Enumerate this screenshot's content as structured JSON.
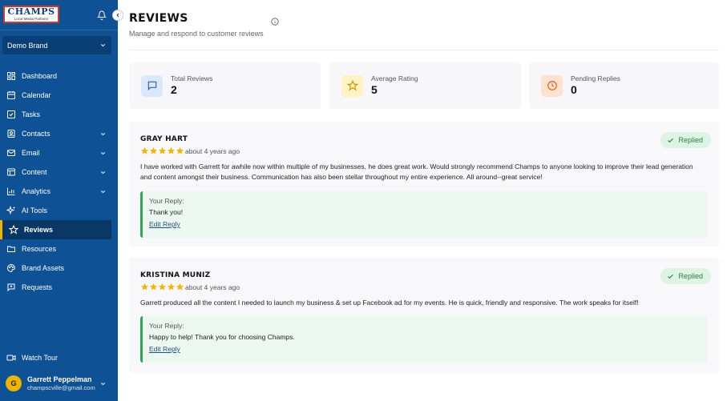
{
  "brand": {
    "logo_title": "CHAMPS",
    "logo_tagline": "Local Media Partners"
  },
  "brand_selector": {
    "value": "Demo Brand"
  },
  "sidebar": {
    "items": [
      {
        "label": "Dashboard",
        "icon": "dashboard-icon"
      },
      {
        "label": "Calendar",
        "icon": "calendar-icon"
      },
      {
        "label": "Tasks",
        "icon": "tasks-icon"
      },
      {
        "label": "Contacts",
        "icon": "contacts-icon",
        "expandable": true
      },
      {
        "label": "Email",
        "icon": "email-icon",
        "expandable": true
      },
      {
        "label": "Content",
        "icon": "content-icon",
        "expandable": true
      },
      {
        "label": "Analytics",
        "icon": "analytics-icon",
        "expandable": true
      },
      {
        "label": "AI Tools",
        "icon": "sparkle-icon"
      },
      {
        "label": "Reviews",
        "icon": "star-icon",
        "active": true
      },
      {
        "label": "Resources",
        "icon": "resources-icon"
      },
      {
        "label": "Brand Assets",
        "icon": "palette-icon"
      },
      {
        "label": "Requests",
        "icon": "requests-icon"
      }
    ],
    "watch_tour": "Watch Tour",
    "user": {
      "initial": "G",
      "name": "Garrett Peppelman",
      "email": "champscville@gmail.com"
    }
  },
  "page": {
    "title": "REVIEWS",
    "subtitle": "Manage and respond to customer reviews"
  },
  "stats": [
    {
      "label": "Total Reviews",
      "value": "2",
      "icon": "chat-icon",
      "color": "#dbe8fb"
    },
    {
      "label": "Average Rating",
      "value": "5",
      "icon": "star-outline-icon",
      "color": "#fdf3c4"
    },
    {
      "label": "Pending Replies",
      "value": "0",
      "icon": "clock-icon",
      "color": "#fde2cf"
    }
  ],
  "reviews": [
    {
      "name": "GRAY HART",
      "rating": 5,
      "time": "about 4 years ago",
      "status": "Replied",
      "text": "I have worked with Garrett for awhile now within multiple of my businesses, he does great work. Would strongly recommend Champs to anyone looking to improve their lead generation and content amongst their business. Communication has also been stellar throughout my entire experience. All around--great service!",
      "reply_label": "Your Reply:",
      "reply": "Thank you!",
      "edit_label": "Edit Reply"
    },
    {
      "name": "KRISTINA MUNIZ",
      "rating": 5,
      "time": "about 4 years ago",
      "status": "Replied",
      "text": "Garrett produced all the content I needed to launch my business & set up Facebook ad for my events. He is quick, friendly and responsive. The work speaks for itself!",
      "reply_label": "Your Reply:",
      "reply": "Happy to help! Thank you for choosing Champs.",
      "edit_label": "Edit Reply"
    }
  ],
  "colors": {
    "sidebar": "#0e5195",
    "active_accent": "#f0b400",
    "star": "#f0b400",
    "replied_green": "#2fa556"
  }
}
